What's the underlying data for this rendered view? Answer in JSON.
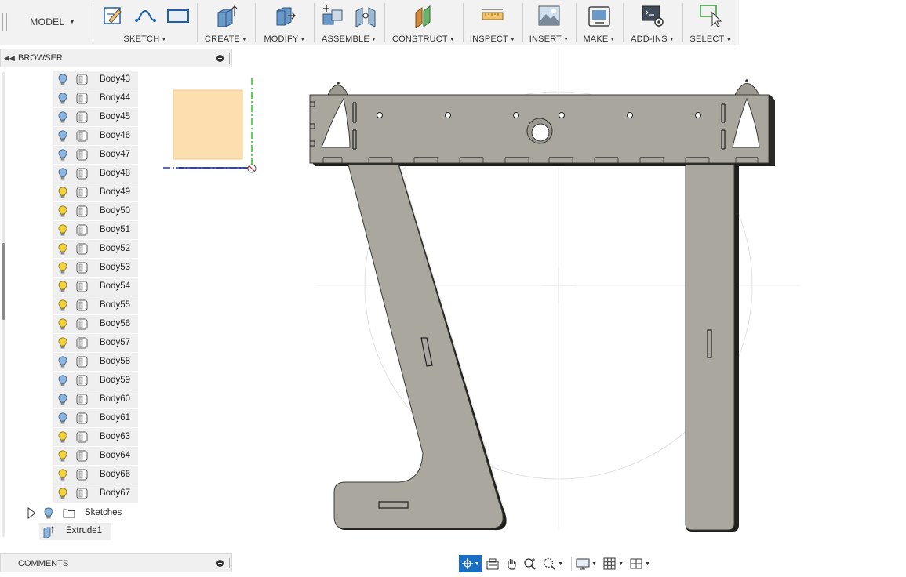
{
  "toolbar": {
    "workspace": "MODEL",
    "groups": [
      {
        "label": "SKETCH",
        "icons": [
          "create-sketch-icon",
          "spline-icon",
          "rectangle-icon"
        ]
      },
      {
        "label": "CREATE",
        "icons": [
          "extrude-box-icon"
        ]
      },
      {
        "label": "MODIFY",
        "icons": [
          "press-pull-icon"
        ]
      },
      {
        "label": "ASSEMBLE",
        "icons": [
          "new-component-icon",
          "joint-icon"
        ]
      },
      {
        "label": "CONSTRUCT",
        "icons": [
          "offset-plane-icon"
        ]
      },
      {
        "label": "INSPECT",
        "icons": [
          "measure-icon"
        ]
      },
      {
        "label": "INSERT",
        "icons": [
          "insert-image-icon"
        ]
      },
      {
        "label": "MAKE",
        "icons": [
          "3d-print-icon"
        ]
      },
      {
        "label": "ADD-INS",
        "icons": [
          "scripts-icon"
        ]
      },
      {
        "label": "SELECT",
        "icons": [
          "select-icon"
        ]
      }
    ]
  },
  "browser": {
    "title": "BROWSER",
    "bodies": [
      {
        "name": "Body43",
        "visible": false
      },
      {
        "name": "Body44",
        "visible": false
      },
      {
        "name": "Body45",
        "visible": false
      },
      {
        "name": "Body46",
        "visible": false
      },
      {
        "name": "Body47",
        "visible": false
      },
      {
        "name": "Body48",
        "visible": false
      },
      {
        "name": "Body49",
        "visible": true
      },
      {
        "name": "Body50",
        "visible": true
      },
      {
        "name": "Body51",
        "visible": true
      },
      {
        "name": "Body52",
        "visible": true
      },
      {
        "name": "Body53",
        "visible": true
      },
      {
        "name": "Body54",
        "visible": true
      },
      {
        "name": "Body55",
        "visible": true
      },
      {
        "name": "Body56",
        "visible": true
      },
      {
        "name": "Body57",
        "visible": true
      },
      {
        "name": "Body58",
        "visible": false
      },
      {
        "name": "Body59",
        "visible": false
      },
      {
        "name": "Body60",
        "visible": false
      },
      {
        "name": "Body61",
        "visible": false
      },
      {
        "name": "Body63",
        "visible": true
      },
      {
        "name": "Body64",
        "visible": true
      },
      {
        "name": "Body66",
        "visible": true
      },
      {
        "name": "Body67",
        "visible": true
      }
    ],
    "sketches_label": "Sketches",
    "extrude_label": "Extrude1"
  },
  "comments": {
    "title": "COMMENTS"
  },
  "navbar": {
    "tools": [
      "orbit-icon",
      "look-at-icon",
      "pan-icon",
      "zoom-icon",
      "zoom-window-icon",
      "display-settings-icon",
      "grid-icon",
      "viewports-icon"
    ]
  },
  "colors": {
    "model_fill": "#aaa89e",
    "model_stroke": "#3a3a36",
    "accent": "#1a6fc4",
    "bulb_on": "#f0d33e",
    "bulb_off": "#8fb6e0"
  }
}
